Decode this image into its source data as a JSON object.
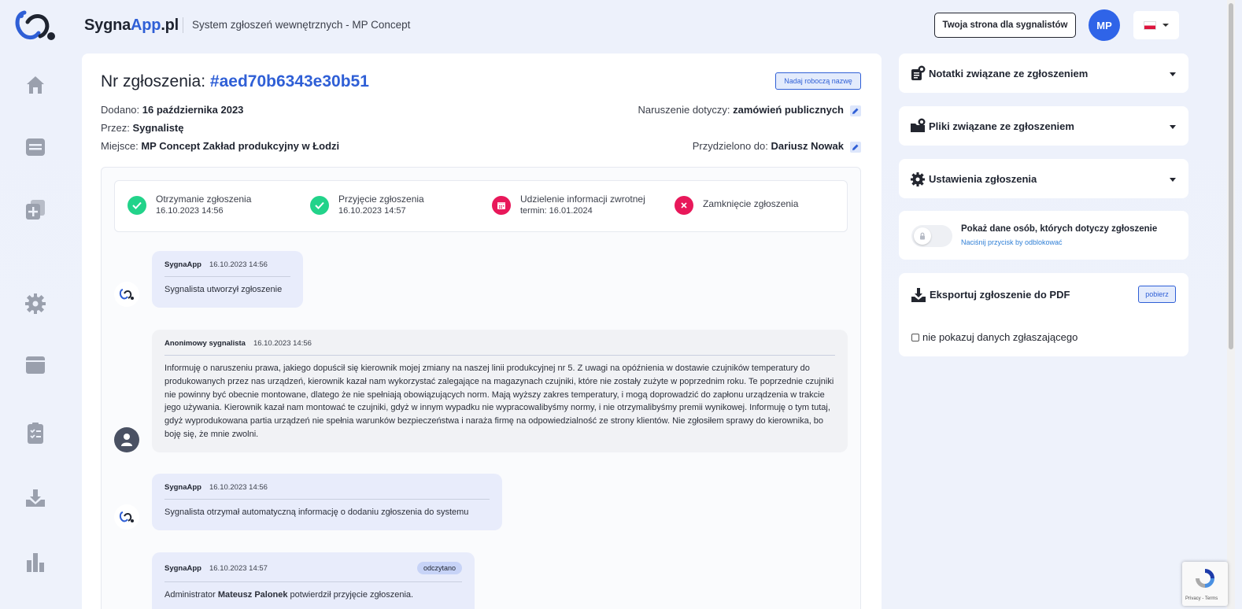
{
  "header": {
    "brand_main": "Sygna",
    "brand_accent": "App",
    "brand_suffix": ".pl",
    "subtitle": "System zgłoszeń wewnętrznych - MP Concept",
    "whistleblower_page_button": "Twoja strona dla sygnalistów",
    "user_initials": "MP",
    "language": "pl-flag"
  },
  "sidebar": {
    "icons": [
      "home-icon",
      "list-icon",
      "add-document-icon",
      "gear-icon",
      "window-icon",
      "checklist-icon",
      "download-icon",
      "bar-chart-icon"
    ]
  },
  "case": {
    "title_label": "Nr zgłoszenia:",
    "id": "#aed70b6343e30b51",
    "working_name_button": "Nadaj roboczą nazwę",
    "added_label": "Dodano:",
    "added_value": "16 października 2023",
    "by_label": "Przez:",
    "by_value": "Sygnalistę",
    "place_label": "Miejsce:",
    "place_value": "MP Concept Zakład produkcyjny w Łodzi",
    "violation_label": "Naruszenie dotyczy:",
    "violation_value": "zamówień publicznych",
    "assigned_label": "Przydzielono do:",
    "assigned_value": "Dariusz Nowak"
  },
  "progress_steps": [
    {
      "label": "Otrzymanie zgłoszenia",
      "sub": "16.10.2023 14:56",
      "status": "done"
    },
    {
      "label": "Przyjęcie zgłoszenia",
      "sub": "16.10.2023 14:57",
      "status": "done"
    },
    {
      "label": "Udzielenie informacji zwrotnej",
      "sub": "termin: 16.01.2024",
      "status": "deadline"
    },
    {
      "label": "Zamknięcie zgłoszenia",
      "sub": "",
      "status": "pending"
    }
  ],
  "messages": [
    {
      "author": "SygnaApp",
      "time": "16.10.2023 14:56",
      "body": "Sygnalista utworzył zgłoszenie"
    },
    {
      "author": "Anonimowy sygnalista",
      "time": "16.10.2023 14:56",
      "body": "Informuję o naruszeniu prawa, jakiego dopuścił się kierownik mojej zmiany na naszej linii produkcyjnej nr 5. Z uwagi na opóźnienia w dostawie czujników temperatury do produkowanych przez nas urządzeń, kierownik kazał nam wykorzystać zalegające na magazynach czujniki, które nie zostały zużyte w poprzednim roku. Te poprzednie czujniki nie powinny być obecnie montowane, dlatego że nie spełniają obowiązujących norm. Mają wyższy zakres temperatury, i mogą doprowadzić do zapłonu urządzenia w trakcie jego używania. Kierownik kazał nam montować te czujniki, gdyż w innym wypadku nie wypracowalibyśmy normy, i nie otrzymalibyśmy premii wynikowej. Informuję o tym tutaj, gdyż wyprodukowana partia urządzeń nie spełnia warunków bezpieczeństwa i naraża firmę na odpowiedzialność ze strony klientów. Nie zgłosiłem sprawy do kierownika, bo boję się, że mnie zwolni."
    },
    {
      "author": "SygnaApp",
      "time": "16.10.2023 14:56",
      "body": "Sygnalista otrzymał automatyczną informację o dodaniu zgłoszenia do systemu"
    },
    {
      "author": "SygnaApp",
      "time": "16.10.2023 14:57",
      "badge": "odczytano",
      "body_prefix": "Administrator ",
      "body_bold": "Mateusz Palonek",
      "body_suffix": " potwierdził przyjęcie zgłoszenia."
    }
  ],
  "right_panel": {
    "notes_title": "Notatki związane ze zgłoszeniem",
    "files_title": "Pliki związane ze zgłoszeniem",
    "settings_title": "Ustawienia zgłoszenia",
    "show_persons_title": "Pokaż dane osób, których dotyczy zgłoszenie",
    "show_persons_hint": "Naciśnij przycisk by odblokować",
    "export_title": "Eksportuj zgłoszenie do PDF",
    "export_button": "pobierz",
    "hide_reporter_label": "nie pokazuj danych zgłaszającego"
  },
  "recaptcha": {
    "text": "Privacy - Terms"
  },
  "colors": {
    "accent": "#2f5fd6",
    "success": "#22d38a",
    "danger": "#e8185a"
  }
}
